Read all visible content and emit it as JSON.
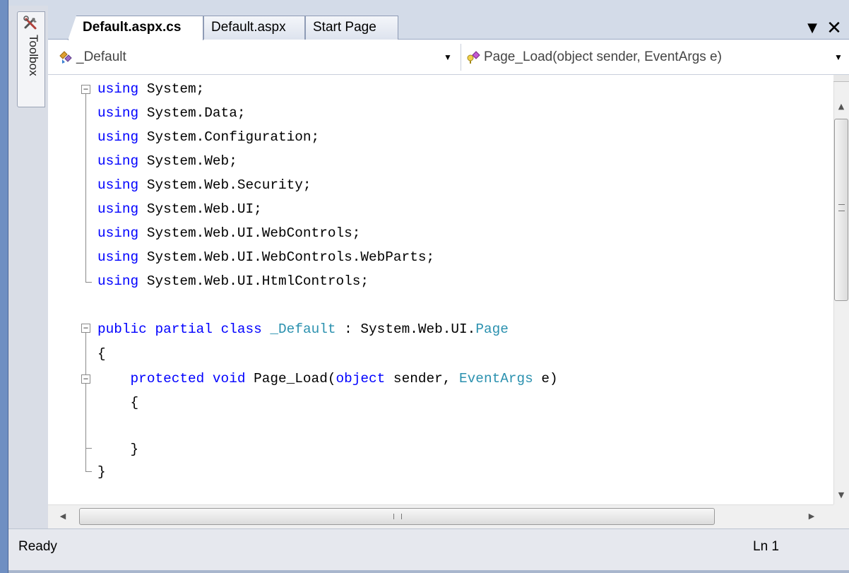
{
  "toolbox": {
    "label": "Toolbox",
    "icon": "toolbox-icon"
  },
  "tabs": [
    {
      "label": "Default.aspx.cs",
      "active": true
    },
    {
      "label": "Default.aspx",
      "active": false
    },
    {
      "label": "Start Page",
      "active": false
    }
  ],
  "tab_strip": {
    "dropdown_icon": "chevron-down-icon",
    "close_symbol": "✕"
  },
  "navigation": {
    "class_combo": {
      "value": "_Default",
      "icon": "class-icon"
    },
    "member_combo": {
      "value": "Page_Load(object sender, EventArgs e)",
      "icon": "method-icon"
    }
  },
  "code_lines": [
    "using System;",
    "using System.Data;",
    "using System.Configuration;",
    "using System.Web;",
    "using System.Web.Security;",
    "using System.Web.UI;",
    "using System.Web.UI.WebControls;",
    "using System.Web.UI.WebControls.WebParts;",
    "using System.Web.UI.HtmlControls;",
    "",
    "public partial class _Default : System.Web.UI.Page",
    "{",
    "    protected void Page_Load(object sender, EventArgs e)",
    "    {",
    "",
    "    }",
    "}"
  ],
  "colors": {
    "keyword": "#0000ff",
    "type": "#2b91af",
    "text": "#000000"
  },
  "status": {
    "text": "Ready",
    "line": "Ln 1"
  }
}
